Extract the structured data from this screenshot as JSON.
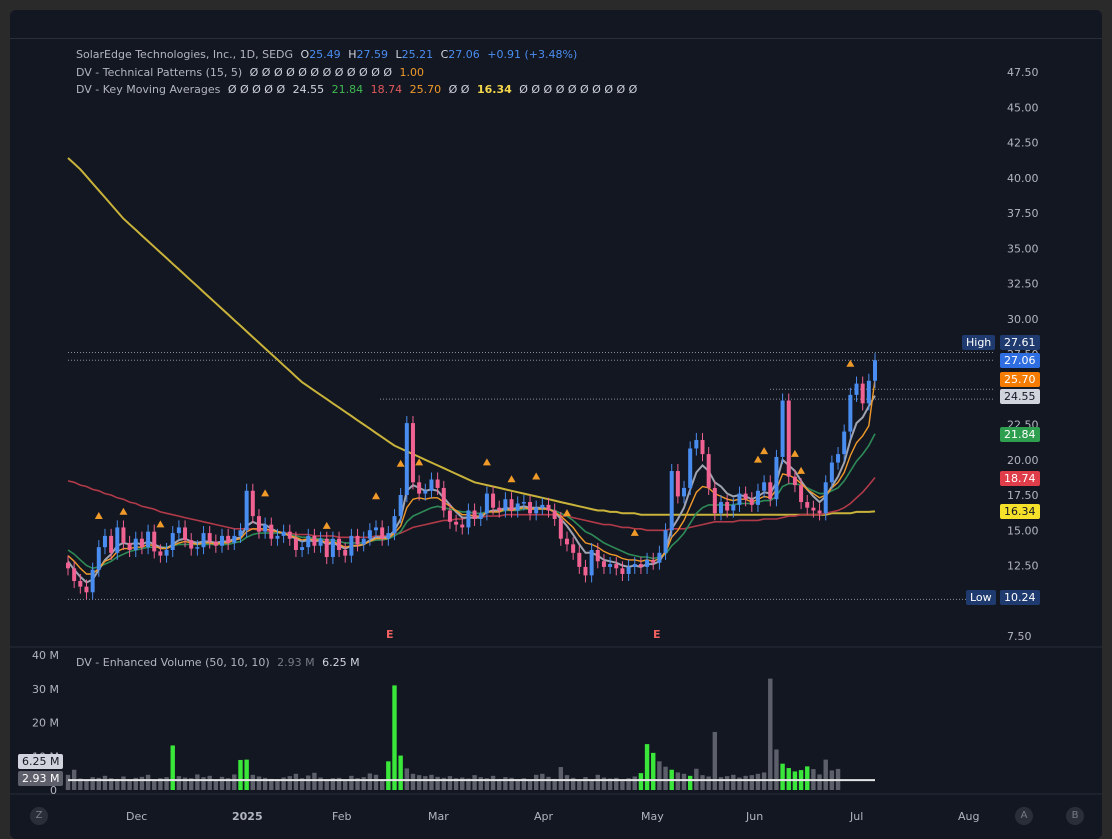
{
  "legend": {
    "symbol_line": "SolarEdge Technologies, Inc., 1D, SEDG",
    "o_label": "O",
    "o_value": "25.49",
    "h_label": "H",
    "h_value": "27.59",
    "l_label": "L",
    "l_value": "25.21",
    "c_label": "C",
    "c_value": "27.06",
    "change": "+0.91 (+3.48%)",
    "patterns_name": "DV - Technical Patterns (15, 5)",
    "patterns_values": "Ø Ø Ø Ø Ø Ø Ø Ø Ø Ø Ø Ø",
    "patterns_last": "1.00",
    "ma_name": "DV - Key Moving Averages",
    "ma_prefix": "Ø Ø Ø Ø Ø",
    "ma_v1": "24.55",
    "ma_v2": "21.84",
    "ma_v3": "18.74",
    "ma_v4": "25.70",
    "ma_mid": "Ø Ø",
    "ma_v5": "16.34",
    "ma_suffix": "Ø Ø Ø Ø Ø Ø Ø Ø Ø Ø",
    "vol_name": "DV - Enhanced Volume (50, 10, 10)",
    "vol_avg": "2.93 M",
    "vol_cur": "6.25 M"
  },
  "badges": {
    "high_label": "High",
    "high_value": "27.61",
    "close_value": "27.06",
    "ma_orange": "25.70",
    "ma_white": "24.55",
    "ma_green": "21.84",
    "ma_red": "18.74",
    "ma_yellow": "16.34",
    "low_label": "Low",
    "low_value": "10.24",
    "vol_cur": "6.25 M",
    "vol_avg": "2.93 M"
  },
  "earnings_marker": "E",
  "buttons": {
    "left": "Z",
    "right_a": "A",
    "right_b": "B"
  },
  "colors": {
    "background": "#131722",
    "up": "#4a8df0",
    "down": "#f06292",
    "ma_orange": "#f09a2a",
    "ma_green": "#2e8b57",
    "ma_red": "#b03a48",
    "ma_yellow": "#c9b33a",
    "ma_white": "#a0a4b0",
    "vol_high": "#39e639",
    "vol_normal": "#5d606b"
  },
  "chart_data": {
    "type": "candlestick",
    "title": "SolarEdge Technologies, Inc., 1D, SEDG",
    "price_ticks": [
      "47.50",
      "45.00",
      "42.50",
      "40.00",
      "37.50",
      "35.00",
      "32.50",
      "30.00",
      "27.50",
      "22.50",
      "20.00",
      "17.50",
      "15.00",
      "12.50",
      "7.50"
    ],
    "price_range": [
      7.5,
      47.5
    ],
    "time_ticks": [
      "Dec",
      "2025",
      "Feb",
      "Mar",
      "Apr",
      "May",
      "Jun",
      "Jul",
      "Aug"
    ],
    "volume_ticks": [
      "40 M",
      "30 M",
      "20 M",
      "10 M",
      "0"
    ],
    "volume_range": [
      0,
      40
    ],
    "close": [
      12.3,
      11.4,
      11.0,
      10.6,
      12.2,
      13.8,
      14.6,
      13.4,
      15.2,
      14.1,
      13.6,
      14.4,
      13.8,
      14.9,
      13.5,
      13.2,
      13.6,
      14.8,
      15.2,
      14.3,
      13.7,
      13.8,
      14.8,
      14.2,
      13.9,
      14.6,
      14.1,
      14.6,
      15.0,
      17.8,
      16.0,
      14.9,
      15.4,
      14.4,
      14.6,
      14.9,
      14.4,
      13.6,
      13.8,
      14.6,
      13.9,
      14.4,
      13.1,
      14.4,
      13.6,
      13.2,
      14.6,
      14.0,
      14.4,
      15.0,
      15.2,
      14.4,
      14.8,
      16.0,
      17.5,
      22.6,
      18.4,
      17.6,
      17.8,
      18.6,
      18.0,
      16.4,
      15.6,
      15.4,
      15.2,
      16.4,
      15.8,
      16.2,
      17.6,
      16.6,
      16.4,
      17.2,
      16.4,
      16.9,
      17.0,
      16.2,
      16.6,
      16.8,
      16.4,
      15.8,
      14.4,
      14.0,
      13.4,
      12.4,
      11.8,
      13.6,
      12.8,
      12.4,
      12.6,
      12.3,
      11.9,
      12.4,
      12.6,
      12.4,
      12.9,
      12.7,
      13.4,
      15.0,
      19.2,
      17.4,
      18.0,
      20.8,
      21.4,
      20.4,
      18.0,
      16.2,
      17.0,
      16.4,
      16.8,
      17.6,
      17.2,
      16.8,
      17.8,
      18.4,
      17.2,
      20.2,
      24.2,
      18.8,
      18.2,
      17.0,
      16.6,
      16.4,
      16.2,
      18.4,
      19.8,
      20.4,
      22.0,
      24.6,
      25.4,
      24.0,
      25.6,
      27.06
    ],
    "volume": [
      4.5,
      6.0,
      3.4,
      3.0,
      3.8,
      3.6,
      4.2,
      3.5,
      3.3,
      4.0,
      3.2,
      3.6,
      3.9,
      4.5,
      3.1,
      3.5,
      3.8,
      13.2,
      4.1,
      3.7,
      3.5,
      4.6,
      3.8,
      4.2,
      3.0,
      3.9,
      3.5,
      4.6,
      8.9,
      9.0,
      4.5,
      4.0,
      3.6,
      3.3,
      3.2,
      3.7,
      4.1,
      4.8,
      3.5,
      4.3,
      5.1,
      3.7,
      3.2,
      3.5,
      3.6,
      2.9,
      4.2,
      3.5,
      3.8,
      4.9,
      4.5,
      3.0,
      8.5,
      31.0,
      10.2,
      6.4,
      4.8,
      4.4,
      4.1,
      4.5,
      3.9,
      3.6,
      4.1,
      3.5,
      3.7,
      3.4,
      4.4,
      3.8,
      3.5,
      4.2,
      3.3,
      3.8,
      3.6,
      3.2,
      3.5,
      3.0,
      4.5,
      4.8,
      3.9,
      3.3,
      6.8,
      4.4,
      3.6,
      3.1,
      3.8,
      3.2,
      4.5,
      3.7,
      3.4,
      3.6,
      3.1,
      3.5,
      4.0,
      5.0,
      13.6,
      11.0,
      8.5,
      6.9,
      6.0,
      5.2,
      4.8,
      4.2,
      6.3,
      4.4,
      4.0,
      17.2,
      3.8,
      4.1,
      4.5,
      3.7,
      4.2,
      4.4,
      4.8,
      5.2,
      33.0,
      12.0,
      7.8,
      6.5,
      5.5,
      5.9,
      7.0,
      6.2,
      4.6,
      9.0,
      5.8,
      6.25
    ],
    "volume_avg": 2.93,
    "volume_high_days": [
      17,
      28,
      29,
      52,
      53,
      54,
      93,
      94,
      95,
      98,
      101,
      116,
      117,
      118,
      119,
      120
    ],
    "ma_fast": [
      12.8,
      12.2,
      11.7,
      11.3,
      11.5,
      12.2,
      12.9,
      13.3,
      13.9,
      14.1,
      14.0,
      14.1,
      14.0,
      14.2,
      14.0,
      13.8,
      13.7,
      14.0,
      14.3,
      14.4,
      14.2,
      14.1,
      14.2,
      14.2,
      14.1,
      14.2,
      14.2,
      14.4,
      14.5,
      15.3,
      15.6,
      15.4,
      15.4,
      15.1,
      14.9,
      14.8,
      14.6,
      14.4,
      14.2,
      14.3,
      14.2,
      14.3,
      14.0,
      14.1,
      13.9,
      13.7,
      13.9,
      13.9,
      14.0,
      14.3,
      14.5,
      14.5,
      14.5,
      15.0,
      15.8,
      17.8,
      18.2,
      18.0,
      17.8,
      17.9,
      17.8,
      17.3,
      16.8,
      16.3,
      15.9,
      15.9,
      15.9,
      15.9,
      16.3,
      16.4,
      16.4,
      16.6,
      16.5,
      16.6,
      16.7,
      16.6,
      16.6,
      16.6,
      16.5,
      16.3,
      15.8,
      15.3,
      14.7,
      14.0,
      13.4,
      13.4,
      13.2,
      12.9,
      12.8,
      12.7,
      12.5,
      12.4,
      12.5,
      12.4,
      12.6,
      12.6,
      12.8,
      13.5,
      15.1,
      15.8,
      16.6,
      17.9,
      19.1,
      19.6,
      19.2,
      18.4,
      18.1,
      17.6,
      17.4,
      17.5,
      17.4,
      17.2,
      17.4,
      17.7,
      17.6,
      18.4,
      20.0,
      19.6,
      19.2,
      18.5,
      17.9,
      17.4,
      17.0,
      17.4,
      18.1,
      18.8,
      19.8,
      21.4,
      22.6,
      23.0,
      23.8,
      24.55
    ],
    "ma_mid": [
      13.6,
      13.3,
      12.9,
      12.5,
      12.3,
      12.4,
      12.6,
      12.8,
      13.1,
      13.3,
      13.5,
      13.6,
      13.7,
      13.8,
      13.8,
      13.8,
      13.8,
      13.9,
      14.0,
      14.0,
      14.0,
      14.0,
      14.0,
      14.0,
      14.0,
      14.0,
      14.0,
      14.1,
      14.2,
      14.5,
      14.7,
      14.8,
      14.8,
      14.8,
      14.8,
      14.8,
      14.7,
      14.6,
      14.5,
      14.5,
      14.4,
      14.4,
      14.3,
      14.3,
      14.2,
      14.1,
      14.1,
      14.1,
      14.1,
      14.2,
      14.3,
      14.3,
      14.4,
      14.6,
      14.9,
      15.6,
      16.0,
      16.2,
      16.4,
      16.6,
      16.7,
      16.6,
      16.5,
      16.4,
      16.3,
      16.3,
      16.2,
      16.2,
      16.3,
      16.3,
      16.3,
      16.4,
      16.4,
      16.4,
      16.5,
      16.5,
      16.5,
      16.5,
      16.5,
      16.4,
      16.2,
      16.0,
      15.7,
      15.3,
      14.9,
      14.7,
      14.4,
      14.1,
      13.9,
      13.7,
      13.5,
      13.3,
      13.2,
      13.1,
      13.1,
      13.0,
      13.1,
      13.3,
      13.9,
      14.3,
      14.8,
      15.5,
      16.2,
      16.6,
      16.8,
      16.8,
      16.8,
      16.8,
      16.8,
      16.9,
      16.9,
      16.9,
      17.0,
      17.1,
      17.1,
      17.4,
      18.1,
      18.3,
      18.3,
      18.2,
      18.0,
      17.8,
      17.6,
      17.6,
      17.8,
      18.0,
      18.5,
      19.2,
      19.9,
      20.4,
      21.0,
      21.84
    ],
    "ma_slow": [
      18.5,
      18.4,
      18.2,
      18.1,
      17.9,
      17.8,
      17.6,
      17.5,
      17.3,
      17.2,
      17.0,
      16.9,
      16.7,
      16.6,
      16.5,
      16.3,
      16.2,
      16.1,
      16.0,
      15.9,
      15.8,
      15.7,
      15.6,
      15.5,
      15.4,
      15.3,
      15.2,
      15.1,
      15.1,
      15.1,
      15.1,
      15.0,
      15.0,
      14.9,
      14.9,
      14.8,
      14.8,
      14.7,
      14.7,
      14.7,
      14.6,
      14.6,
      14.6,
      14.6,
      14.5,
      14.5,
      14.5,
      14.5,
      14.5,
      14.5,
      14.6,
      14.6,
      14.6,
      14.7,
      14.8,
      15.0,
      15.2,
      15.3,
      15.4,
      15.5,
      15.6,
      15.7,
      15.7,
      15.8,
      15.8,
      15.9,
      15.9,
      15.9,
      16.0,
      16.0,
      16.0,
      16.1,
      16.1,
      16.1,
      16.1,
      16.1,
      16.1,
      16.1,
      16.1,
      16.1,
      16.0,
      16.0,
      15.9,
      15.8,
      15.7,
      15.6,
      15.5,
      15.4,
      15.4,
      15.3,
      15.2,
      15.2,
      15.1,
      15.1,
      15.0,
      15.0,
      15.0,
      15.0,
      15.1,
      15.1,
      15.1,
      15.2,
      15.3,
      15.4,
      15.5,
      15.6,
      15.6,
      15.6,
      15.6,
      15.7,
      15.7,
      15.7,
      15.7,
      15.8,
      15.8,
      15.8,
      15.9,
      16.0,
      16.0,
      16.1,
      16.1,
      16.1,
      16.1,
      16.2,
      16.3,
      16.4,
      16.6,
      16.9,
      17.3,
      17.7,
      18.2,
      18.74
    ],
    "ma_long": [
      41.4,
      41.0,
      40.6,
      40.1,
      39.6,
      39.1,
      38.6,
      38.1,
      37.6,
      37.1,
      36.7,
      36.3,
      35.9,
      35.5,
      35.1,
      34.7,
      34.3,
      33.9,
      33.5,
      33.1,
      32.7,
      32.3,
      31.9,
      31.5,
      31.1,
      30.7,
      30.3,
      29.9,
      29.5,
      29.1,
      28.7,
      28.3,
      27.9,
      27.5,
      27.1,
      26.7,
      26.3,
      25.9,
      25.5,
      25.2,
      24.9,
      24.6,
      24.3,
      24.0,
      23.7,
      23.4,
      23.1,
      22.8,
      22.5,
      22.2,
      21.9,
      21.6,
      21.3,
      21.0,
      20.8,
      20.6,
      20.4,
      20.2,
      20.0,
      19.8,
      19.6,
      19.4,
      19.2,
      19.0,
      18.8,
      18.6,
      18.4,
      18.3,
      18.2,
      18.1,
      18.0,
      17.9,
      17.8,
      17.7,
      17.6,
      17.5,
      17.4,
      17.3,
      17.2,
      17.1,
      17.0,
      16.9,
      16.8,
      16.7,
      16.6,
      16.5,
      16.4,
      16.4,
      16.3,
      16.3,
      16.2,
      16.2,
      16.2,
      16.1,
      16.1,
      16.1,
      16.1,
      16.1,
      16.1,
      16.1,
      16.1,
      16.1,
      16.1,
      16.1,
      16.1,
      16.1,
      16.1,
      16.1,
      16.1,
      16.1,
      16.1,
      16.1,
      16.1,
      16.1,
      16.1,
      16.1,
      16.1,
      16.1,
      16.1,
      16.1,
      16.1,
      16.1,
      16.1,
      16.1,
      16.2,
      16.2,
      16.2,
      16.2,
      16.3,
      16.3,
      16.3,
      16.34
    ],
    "ma_mid2": [
      13.2,
      12.8,
      12.3,
      11.9,
      11.9,
      12.3,
      12.8,
      13.0,
      13.5,
      13.7,
      13.7,
      13.8,
      13.8,
      14.0,
      13.9,
      13.7,
      13.7,
      13.9,
      14.1,
      14.2,
      14.1,
      14.0,
      14.1,
      14.1,
      14.0,
      14.1,
      14.1,
      14.3,
      14.4,
      14.9,
      15.1,
      15.1,
      15.1,
      15.0,
      14.9,
      14.8,
      14.6,
      14.5,
      14.3,
      14.4,
      14.3,
      14.3,
      14.1,
      14.2,
      14.0,
      13.8,
      13.9,
      13.9,
      14.0,
      14.2,
      14.4,
      14.4,
      14.4,
      14.8,
      15.3,
      16.6,
      17.2,
      17.3,
      17.2,
      17.3,
      17.3,
      17.0,
      16.7,
      16.4,
      16.1,
      16.1,
      16.0,
      16.0,
      16.3,
      16.3,
      16.3,
      16.5,
      16.4,
      16.5,
      16.6,
      16.5,
      16.5,
      16.5,
      16.5,
      16.3,
      16.0,
      15.6,
      15.2,
      14.6,
      14.1,
      14.0,
      13.8,
      13.5,
      13.3,
      13.2,
      13.0,
      12.9,
      12.9,
      12.8,
      12.9,
      12.8,
      13.0,
      13.4,
      14.5,
      15.0,
      15.7,
      16.7,
      17.7,
      18.1,
      18.0,
      17.6,
      17.4,
      17.2,
      17.1,
      17.2,
      17.2,
      17.0,
      17.2,
      17.4,
      17.3,
      17.9,
      19.0,
      18.9,
      18.7,
      18.3,
      17.9,
      17.6,
      17.3,
      17.5,
      18.0,
      18.4,
      19.1,
      20.3,
      21.2,
      21.7,
      22.4,
      25.7
    ]
  }
}
